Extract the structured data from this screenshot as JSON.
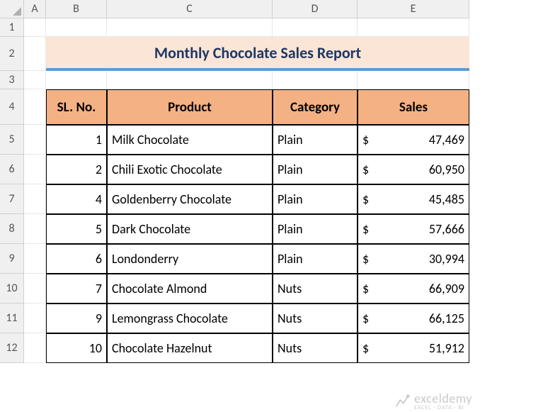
{
  "columns": [
    "A",
    "B",
    "C",
    "D",
    "E"
  ],
  "rows": [
    "1",
    "2",
    "3",
    "4",
    "5",
    "6",
    "7",
    "8",
    "9",
    "10",
    "11",
    "12"
  ],
  "title": "Monthly Chocolate Sales Report",
  "headers": {
    "sl": "SL. No.",
    "product": "Product",
    "category": "Category",
    "sales": "Sales"
  },
  "data": [
    {
      "sl": "1",
      "product": "Milk Chocolate",
      "category": "Plain",
      "sales": "47,469"
    },
    {
      "sl": "2",
      "product": "Chili Exotic Chocolate",
      "category": "Plain",
      "sales": "60,950"
    },
    {
      "sl": "4",
      "product": "Goldenberry Chocolate",
      "category": "Plain",
      "sales": "45,485"
    },
    {
      "sl": "5",
      "product": "Dark Chocolate",
      "category": "Plain",
      "sales": "57,666"
    },
    {
      "sl": "6",
      "product": "Londonderry",
      "category": "Plain",
      "sales": "30,994"
    },
    {
      "sl": "7",
      "product": "Chocolate Almond",
      "category": "Nuts",
      "sales": "66,909"
    },
    {
      "sl": "9",
      "product": "Lemongrass Chocolate",
      "category": "Nuts",
      "sales": "66,125"
    },
    {
      "sl": "10",
      "product": "Chocolate Hazelnut",
      "category": "Nuts",
      "sales": "51,912"
    }
  ],
  "currency": "$",
  "watermark": {
    "name": "exceldemy",
    "tag": "EXCEL · DATA · BI"
  }
}
